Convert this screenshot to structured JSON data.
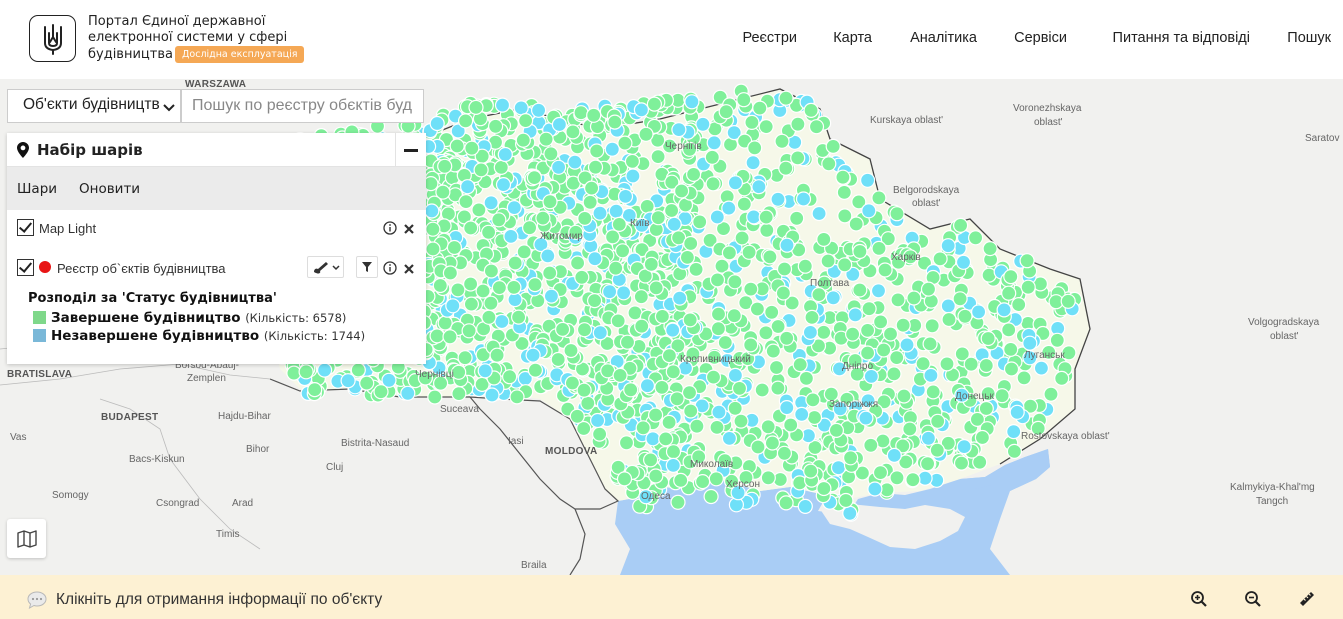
{
  "header": {
    "brand_line1": "Портал Єдиної державної",
    "brand_line2": "електронної системи у сфері",
    "brand_line3": "будівництва",
    "badge": "Дослідна експлуатація",
    "nav": [
      "Реєстри",
      "Карта",
      "Аналітика",
      "Сервіси",
      "Питання та відповіді",
      "Пошук"
    ]
  },
  "search": {
    "select_value": "Об'єкти будівництва",
    "placeholder": "Пошук по реєстру обєктів будівництва"
  },
  "layers_panel": {
    "title": "Набір шарів",
    "tabs": [
      "Шари",
      "Оновити"
    ],
    "layers": [
      {
        "name": "Map Light",
        "checked": true
      },
      {
        "name": "Реєстр об`єктів будівництва",
        "checked": true,
        "color": "#e81515"
      }
    ],
    "legend": {
      "title": "Розподіл за 'Статус будівництва'",
      "items": [
        {
          "label": "Завершене будівництво",
          "count": "(Кількість: 6578)",
          "color": "#7fd88a"
        },
        {
          "label": "Незавершене будівництво",
          "count": "(Кількість: 1744)",
          "color": "#7ab8d8"
        }
      ]
    }
  },
  "map_labels": {
    "warszawa": "WARSZAWA",
    "kursk": "Kurskaya oblast'",
    "voronezh1": "Voronezhskaya",
    "voronezh2": "oblast'",
    "saratov": "Saratov",
    "belgorod1": "Belgorodskaya",
    "belgorod2": "oblast'",
    "volgograd1": "Volgogradskaya",
    "volgograd2": "oblast'",
    "rostov": "Rostovskaya oblast'",
    "kalmykia1": "Kalmykiya-Khal'mg",
    "kalmykia2": "Tangch",
    "bratislava": "BRATISLAVA",
    "budapest": "BUDAPEST",
    "moldova": "MOLDOVA",
    "chernihiv": "Чернігів",
    "zhytomyr": "Житомир",
    "kyiv": "Київ",
    "poltava": "Полтава",
    "kharkiv": "Харків",
    "kropyvnytskyi": "Кропивницький",
    "dnipro": "Дніпро",
    "zaporizhzhia": "Запоріжжя",
    "donetsk": "Донецьк",
    "luhansk": "Луганськ",
    "mykolaiv": "Миколаїв",
    "odesa": "Одеса",
    "kherson": "Херсон",
    "chernivtsi": "Чернівці",
    "suceava": "Suceava",
    "iasi": "Iasi",
    "bistrita": "Bistrita-Nasaud",
    "cluj": "Cluj",
    "bihor": "Bihor",
    "hajdu": "Hajdu-Bihar",
    "borsod1": "Borsod-Abaúj-",
    "borsod2": "Zemplen",
    "vas": "Vas",
    "bacs": "Bacs-Kiskun",
    "somogy": "Somogy",
    "csongrad": "Csongrad",
    "arad": "Arad",
    "timis": "Timis",
    "braila": "Braila"
  },
  "colors": {
    "completed": "#7ff09a",
    "incomplete": "#6fe0f8",
    "sea": "#a9cdf5",
    "land": "#f1f1ef",
    "badge": "#f5a855",
    "status_bar": "#fdf1d3"
  },
  "status_bar": {
    "message": "Клікніть для отримання інформації по об'єкту"
  }
}
